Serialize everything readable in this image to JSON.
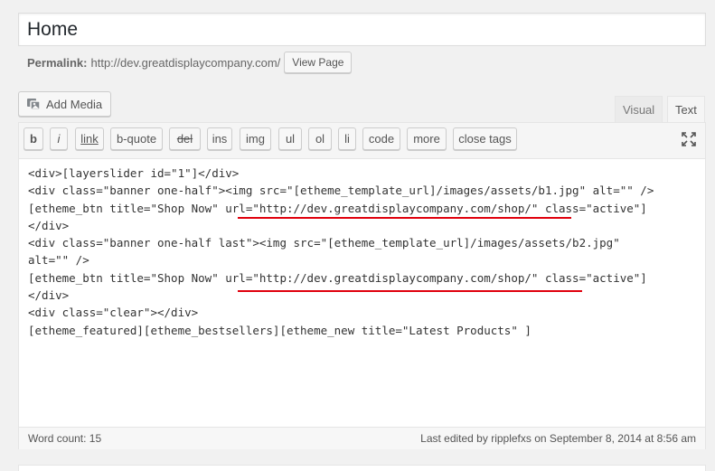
{
  "title": "Home",
  "permalink": {
    "label": "Permalink:",
    "url": "http://dev.greatdisplaycompany.com/",
    "view_button": "View Page"
  },
  "add_media": "Add Media",
  "tabs": {
    "visual": "Visual",
    "text": "Text"
  },
  "quicktags": [
    "b",
    "i",
    "link",
    "b-quote",
    "del",
    "ins",
    "img",
    "ul",
    "ol",
    "li",
    "code",
    "more",
    "close tags"
  ],
  "code_lines": [
    "<div>[layerslider id=\"1\"]</div>",
    "<div class=\"banner one-half\"><img src=\"[etheme_template_url]/images/assets/b1.jpg\" alt=\"\" />",
    "[etheme_btn title=\"Shop Now\" url=\"http://dev.greatdisplaycompany.com/shop/\" class=\"active\"]",
    "</div>",
    "<div class=\"banner one-half last\"><img src=\"[etheme_template_url]/images/assets/b2.jpg\"",
    "alt=\"\" />",
    "[etheme_btn title=\"Shop Now\" url=\"http://dev.greatdisplaycompany.com/shop/\" class=\"active\"]",
    "</div>",
    "<div class=\"clear\"></div>",
    "[etheme_featured][etheme_bestsellers][etheme_new title=\"Latest Products\" ]"
  ],
  "status": {
    "word_count": "Word count: 15",
    "last_edited": "Last edited by ripplefxs on September 8, 2014 at 8:56 am"
  },
  "icons": {
    "add_media": "media-icon",
    "fullscreen": "fullscreen-icon"
  },
  "colors": {
    "annotation": "#e0000d"
  }
}
